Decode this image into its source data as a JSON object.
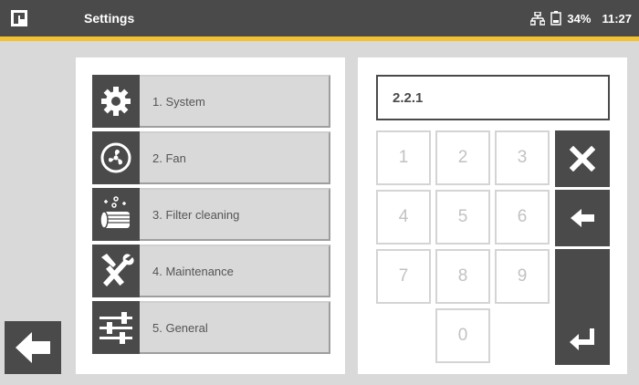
{
  "header": {
    "title": "Settings",
    "logo_icon": "app-logo-icon",
    "network_icon": "network-icon",
    "battery_icon": "battery-icon",
    "battery": "34%",
    "time": "11:27"
  },
  "colors": {
    "header_bg": "#4a4a4a",
    "accent": "#f2c230",
    "background": "#d9d9d9"
  },
  "menu": {
    "items": [
      {
        "label": "1. System",
        "icon": "gear-icon"
      },
      {
        "label": "2. Fan",
        "icon": "fan-icon"
      },
      {
        "label": "3. Filter cleaning",
        "icon": "filter-cleaning-icon"
      },
      {
        "label": "4. Maintenance",
        "icon": "tools-icon"
      },
      {
        "label": "5. General",
        "icon": "sliders-icon"
      }
    ]
  },
  "keypad": {
    "display": "2.2.1",
    "keys": [
      "1",
      "2",
      "3",
      "4",
      "5",
      "6",
      "7",
      "8",
      "9",
      "0"
    ],
    "clear_icon": "close-icon",
    "backspace_icon": "backspace-arrow-icon",
    "enter_icon": "enter-icon"
  },
  "nav": {
    "back_icon": "back-arrow-icon"
  }
}
